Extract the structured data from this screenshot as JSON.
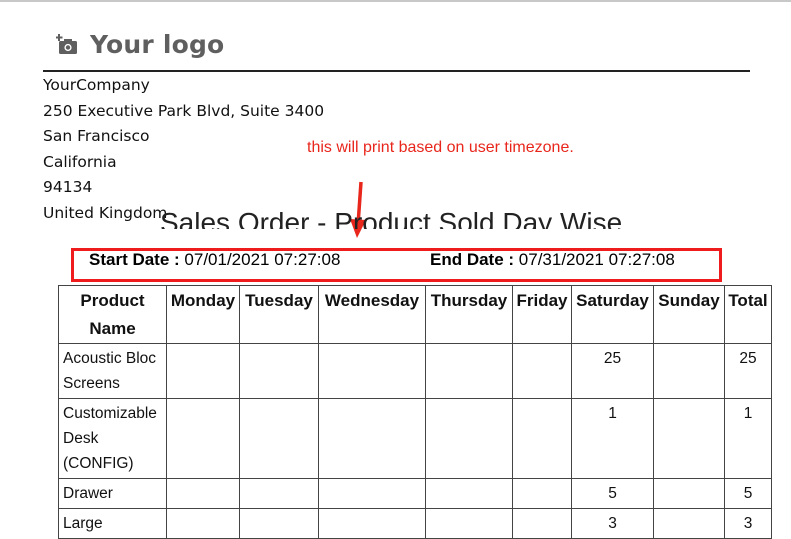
{
  "logo": {
    "text": "Your logo",
    "icon": "camera-add-icon"
  },
  "company": {
    "lines": [
      "YourCompany",
      "250 Executive Park Blvd, Suite 3400",
      "San Francisco",
      "California",
      "94134",
      "United Kingdom"
    ]
  },
  "annotation": {
    "note": "this will print based on user timezone.",
    "color": "#e8261c"
  },
  "report": {
    "title": "Sales Order - Product Sold Day Wise",
    "start_label": "Start Date :",
    "start_value": "07/01/2021 07:27:08",
    "end_label": "End Date :",
    "end_value": "07/31/2021 07:27:08"
  },
  "table": {
    "headers": [
      "Product Name",
      "Monday",
      "Tuesday",
      "Wednesday",
      "Thursday",
      "Friday",
      "Saturday",
      "Sunday",
      "Total"
    ],
    "rows": [
      {
        "name": "Acoustic Bloc Screens",
        "cells": [
          "",
          "",
          "",
          "",
          "",
          "25",
          "",
          "25"
        ]
      },
      {
        "name": "Customizable Desk (CONFIG)",
        "cells": [
          "",
          "",
          "",
          "",
          "",
          "1",
          "",
          "1"
        ]
      },
      {
        "name": "Drawer",
        "cells": [
          "",
          "",
          "",
          "",
          "",
          "5",
          "",
          "5"
        ]
      },
      {
        "name": "Large",
        "cells": [
          "",
          "",
          "",
          "",
          "",
          "3",
          "",
          "3"
        ]
      }
    ]
  }
}
